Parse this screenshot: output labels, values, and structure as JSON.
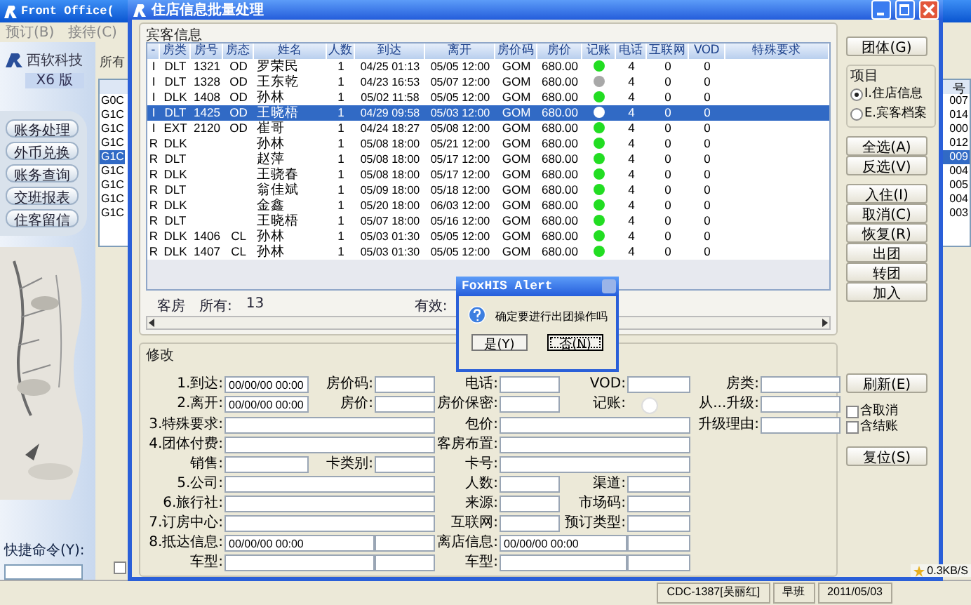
{
  "app": {
    "title": "Front Office(",
    "menu": [
      "预订(B)",
      "接待(C)"
    ],
    "logo": "西软科技",
    "version": "X6 版",
    "nav": [
      "账务处理",
      "外币兑换",
      "账务查询",
      "交班报表",
      "住客留信"
    ],
    "list_label": "所有",
    "list_header": "号",
    "list_rows": [
      {
        "code": "G0C",
        "number": "007",
        "selected": false
      },
      {
        "code": "G1C",
        "number": "014",
        "selected": false
      },
      {
        "code": "G1C",
        "number": "000",
        "selected": false
      },
      {
        "code": "G1C",
        "number": "012",
        "selected": false
      },
      {
        "code": "G1C",
        "number": "009",
        "selected": true
      },
      {
        "code": "G1C",
        "number": "004",
        "selected": false
      },
      {
        "code": "G1C",
        "number": "005",
        "selected": false
      },
      {
        "code": "G1C",
        "number": "004",
        "selected": false
      },
      {
        "code": "G1C",
        "number": "003",
        "selected": false
      }
    ],
    "command_label": "快捷命令(Y):",
    "tray": "0.3KB/S"
  },
  "window": {
    "title": "住店信息批量处理"
  },
  "guests": {
    "title": "宾客信息",
    "columns": [
      "-",
      "房类",
      "房号",
      "房态",
      "姓名",
      "人数",
      "到达",
      "离开",
      "房价码",
      "房价",
      "记账",
      "电话",
      "互联网",
      "VOD",
      "特殊要求"
    ],
    "rows": [
      {
        "status": "I",
        "room_type": "DLT",
        "room": "1321",
        "room_state": "OD",
        "name": "罗荣民",
        "persons": "1",
        "arrival": "04/25 01:13",
        "departure": "05/05 12:00",
        "rate_code": "GOM",
        "rate": "680.00",
        "color": "#22dd22",
        "phone": "4",
        "internet": "0",
        "vod": "0",
        "selected": false
      },
      {
        "status": "I",
        "room_type": "DLT",
        "room": "1328",
        "room_state": "OD",
        "name": "王东乾",
        "persons": "1",
        "arrival": "04/23 16:53",
        "departure": "05/07 12:00",
        "rate_code": "GOM",
        "rate": "680.00",
        "color": "#a8a8a8",
        "phone": "4",
        "internet": "0",
        "vod": "0",
        "selected": false
      },
      {
        "status": "I",
        "room_type": "DLK",
        "room": "1408",
        "room_state": "OD",
        "name": "孙林",
        "persons": "1",
        "arrival": "05/02 11:58",
        "departure": "05/05 12:00",
        "rate_code": "GOM",
        "rate": "680.00",
        "color": "#22dd22",
        "phone": "4",
        "internet": "0",
        "vod": "0",
        "selected": false
      },
      {
        "status": "I",
        "room_type": "DLT",
        "room": "1425",
        "room_state": "OD",
        "name": "王晓梧",
        "persons": "1",
        "arrival": "04/29 09:58",
        "departure": "05/03 12:00",
        "rate_code": "GOM",
        "rate": "680.00",
        "color": "#ffffff",
        "phone": "4",
        "internet": "0",
        "vod": "0",
        "selected": true
      },
      {
        "status": "I",
        "room_type": "EXT",
        "room": "2120",
        "room_state": "OD",
        "name": "崔哥",
        "persons": "1",
        "arrival": "04/24 18:27",
        "departure": "05/08 12:00",
        "rate_code": "GOM",
        "rate": "680.00",
        "color": "#22dd22",
        "phone": "4",
        "internet": "0",
        "vod": "0",
        "selected": false
      },
      {
        "status": "R",
        "room_type": "DLK",
        "name": "孙林",
        "persons": "1",
        "arrival": "05/08 18:00",
        "departure": "05/21 12:00",
        "rate_code": "GOM",
        "rate": "680.00",
        "color": "#22dd22",
        "phone": "4",
        "internet": "0",
        "vod": "0",
        "selected": false
      },
      {
        "status": "R",
        "room_type": "DLT",
        "name": "赵萍",
        "persons": "1",
        "arrival": "05/08 18:00",
        "departure": "05/17 12:00",
        "rate_code": "GOM",
        "rate": "680.00",
        "color": "#22dd22",
        "phone": "4",
        "internet": "0",
        "vod": "0",
        "selected": false
      },
      {
        "status": "R",
        "room_type": "DLK",
        "name": "王骁春",
        "persons": "1",
        "arrival": "05/08 18:00",
        "departure": "05/17 12:00",
        "rate_code": "GOM",
        "rate": "680.00",
        "color": "#22dd22",
        "phone": "4",
        "internet": "0",
        "vod": "0",
        "selected": false
      },
      {
        "status": "R",
        "room_type": "DLT",
        "name": "翁佳斌",
        "persons": "1",
        "arrival": "05/09 18:00",
        "departure": "05/18 12:00",
        "rate_code": "GOM",
        "rate": "680.00",
        "color": "#22dd22",
        "phone": "4",
        "internet": "0",
        "vod": "0",
        "selected": false
      },
      {
        "status": "R",
        "room_type": "DLK",
        "name": "金鑫",
        "persons": "1",
        "arrival": "05/20 18:00",
        "departure": "06/03 12:00",
        "rate_code": "GOM",
        "rate": "680.00",
        "color": "#22dd22",
        "phone": "4",
        "internet": "0",
        "vod": "0",
        "selected": false
      },
      {
        "status": "R",
        "room_type": "DLT",
        "name": "王晓梧",
        "persons": "1",
        "arrival": "05/07 18:00",
        "departure": "05/16 12:00",
        "rate_code": "GOM",
        "rate": "680.00",
        "color": "#22dd22",
        "phone": "4",
        "internet": "0",
        "vod": "0",
        "selected": false
      },
      {
        "status": "R",
        "room_type": "DLK",
        "room": "1406",
        "room_state": "CL",
        "name": "孙林",
        "persons": "1",
        "arrival": "05/03 01:30",
        "departure": "05/05 12:00",
        "rate_code": "GOM",
        "rate": "680.00",
        "color": "#22dd22",
        "phone": "4",
        "internet": "0",
        "vod": "0",
        "selected": false
      },
      {
        "status": "R",
        "room_type": "DLK",
        "room": "1407",
        "room_state": "CL",
        "name": "孙林",
        "persons": "1",
        "arrival": "05/03 01:30",
        "departure": "05/05 12:00",
        "rate_code": "GOM",
        "rate": "680.00",
        "color": "#22dd22",
        "phone": "4",
        "internet": "0",
        "vod": "0",
        "selected": false
      }
    ],
    "summary": {
      "label": "客房",
      "filter": "所有:",
      "count": "13",
      "valid": "有效:"
    }
  },
  "edit": {
    "title": "修改",
    "rows": [
      [
        {
          "kind": "field",
          "label": "1.到达:",
          "value": "00/00/00 00:00"
        },
        {
          "kind": "field",
          "label": "房价码:"
        },
        {
          "kind": "field",
          "label": "电话:"
        },
        {
          "kind": "field",
          "label": "VOD:"
        },
        {
          "kind": "field",
          "label": "房类:"
        }
      ],
      [
        {
          "kind": "field",
          "label": "2.离开:",
          "value": "00/00/00 00:00"
        },
        {
          "kind": "field",
          "label": "房价:"
        },
        {
          "kind": "field",
          "label": "房价保密:"
        },
        {
          "kind": "indicator",
          "label": "记账:"
        },
        {
          "kind": "field",
          "label": "从...升级:"
        }
      ],
      [
        {
          "kind": "wide",
          "label": "3.特殊要求:"
        },
        "",
        {
          "kind": "wide",
          "label": "包价:"
        },
        "",
        {
          "kind": "field",
          "label": "升级理由:"
        }
      ],
      [
        {
          "kind": "wide",
          "label": "4.团体付费:"
        },
        "",
        {
          "kind": "wide",
          "label": "客房布置:"
        }
      ],
      [
        {
          "kind": "field",
          "label": "销售:"
        },
        {
          "kind": "field",
          "label": "卡类别:"
        },
        {
          "kind": "wide",
          "label": "卡号:"
        }
      ],
      [
        {
          "kind": "wide",
          "label": "5.公司:"
        },
        "",
        {
          "kind": "field",
          "label": "人数:"
        },
        {
          "kind": "field",
          "label": "渠道:"
        }
      ],
      [
        {
          "kind": "wide",
          "label": "6.旅行社:"
        },
        "",
        {
          "kind": "field",
          "label": "来源:"
        },
        {
          "kind": "field",
          "label": "市场码:"
        }
      ],
      [
        {
          "kind": "wide",
          "label": "7.订房中心:"
        },
        "",
        {
          "kind": "field",
          "label": "互联网:"
        },
        {
          "kind": "field",
          "label": "预订类型:"
        }
      ],
      [
        {
          "kind": "long",
          "label": "8.抵达信息:",
          "value": "00/00/00 00:00"
        },
        {
          "kind": "field"
        },
        {
          "kind": "long",
          "label": "离店信息:",
          "value": "00/00/00 00:00"
        },
        {
          "kind": "field"
        }
      ],
      [
        {
          "kind": "long",
          "label": "车型:"
        },
        {
          "kind": "field"
        },
        {
          "kind": "long",
          "label": "车型:"
        },
        {
          "kind": "field"
        }
      ]
    ]
  },
  "actions": {
    "top": [
      [
        {
          "kind": "button",
          "label": "团体(G)"
        }
      ],
      [
        {
          "kind": "radio_group",
          "title": "项目",
          "options": [
            {
              "label": "I.住店信息",
              "selected": true
            },
            {
              "label": "E.宾客档案",
              "selected": false
            }
          ]
        }
      ],
      [
        {
          "kind": "button",
          "label": "全选(A)"
        },
        {
          "kind": "button",
          "label": "反选(V)"
        }
      ],
      [
        {
          "kind": "button",
          "label": "入住(I)"
        },
        {
          "kind": "button",
          "label": "取消(C)"
        },
        {
          "kind": "button",
          "label": "恢复(R)"
        },
        {
          "kind": "button",
          "label": "出团"
        },
        {
          "kind": "button",
          "label": "转团"
        },
        {
          "kind": "button",
          "label": "加入"
        }
      ]
    ],
    "bottom": [
      [
        {
          "kind": "button",
          "label": "刷新(E)"
        }
      ],
      [
        {
          "kind": "checkbox",
          "label": "含取消",
          "checked": false
        },
        {
          "kind": "checkbox",
          "label": "含结账",
          "checked": false
        }
      ],
      [
        {
          "kind": "button",
          "label": "复位(S)"
        }
      ]
    ]
  },
  "dialog": {
    "title": "FoxHIS Alert",
    "message": "确定要进行出团操作吗",
    "buttons": [
      {
        "label": "是(Y)",
        "focused": false
      },
      {
        "label": "否(N)",
        "focused": true
      }
    ]
  },
  "status_bar": [
    "CDC-1387[吴丽红]",
    "早班",
    "2011/05/03"
  ]
}
